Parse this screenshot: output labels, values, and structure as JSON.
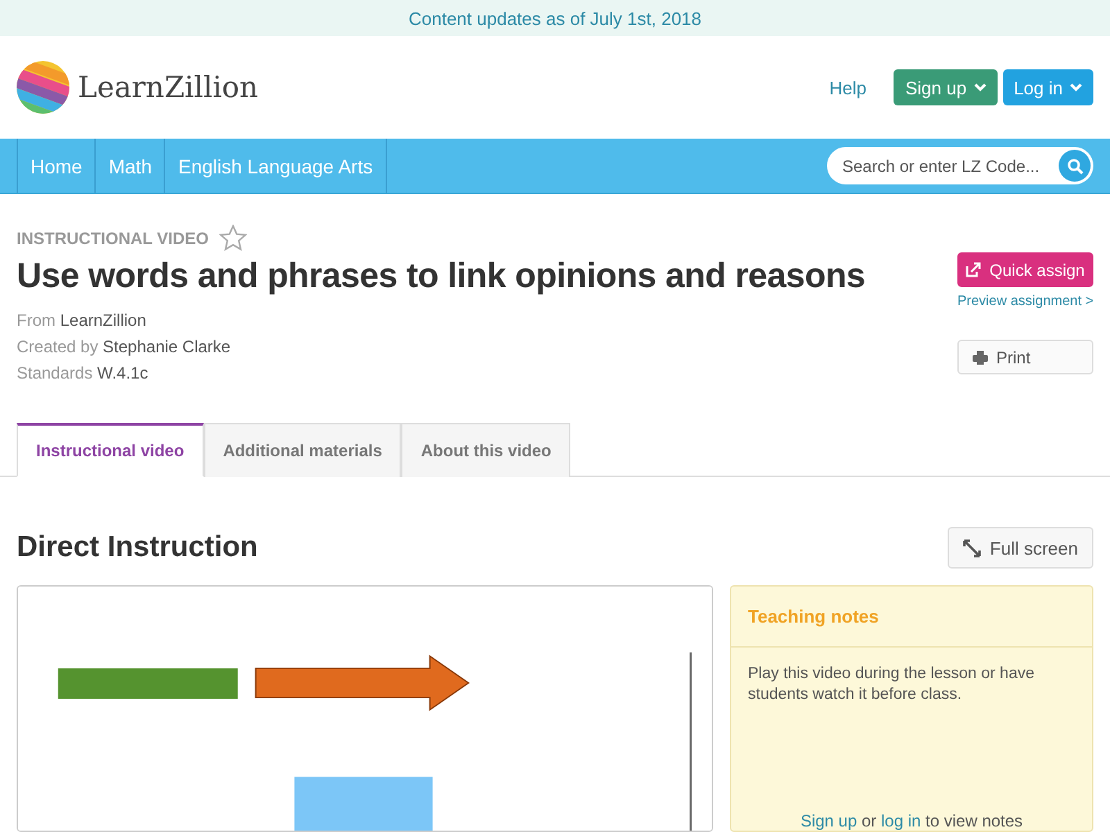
{
  "banner": "Content updates as of July 1st, 2018",
  "header": {
    "logo_text": "LearnZillion",
    "help": "Help",
    "buttons": [
      {
        "label": "Sign up",
        "kind": "signup"
      },
      {
        "label": "Log in",
        "kind": "login"
      }
    ]
  },
  "nav": {
    "items": [
      {
        "label": "Home"
      },
      {
        "label": "Math"
      },
      {
        "label": "English Language Arts"
      }
    ],
    "search": {
      "placeholder": "Search or enter LZ Code..."
    }
  },
  "lesson": {
    "type_label": "INSTRUCTIONAL VIDEO",
    "favorited": false,
    "title": "Use words and phrases to link opinions and reasons",
    "meta": [
      {
        "label": "From",
        "value": "LearnZillion"
      },
      {
        "label": "Created by",
        "value": "Stephanie Clarke"
      },
      {
        "label": "Standards",
        "value": "W.4.1c"
      }
    ],
    "quick_assign": "Quick assign",
    "preview_link": "Preview assignment >",
    "print": "Print"
  },
  "tabs": [
    {
      "label": "Instructional video",
      "selected": true
    },
    {
      "label": "Additional materials",
      "selected": false
    },
    {
      "label": "About this video",
      "selected": false
    }
  ],
  "section": {
    "title": "Direct Instruction",
    "full_screen": "Full screen"
  },
  "notes": {
    "title": "Teaching notes",
    "body": "Play this video during the lesson or have students watch it before class.",
    "footer": [
      {
        "text": "Sign up",
        "link": true
      },
      {
        "text": " or ",
        "link": false
      },
      {
        "text": "log in",
        "link": true
      },
      {
        "text": " to view notes",
        "link": false
      }
    ]
  }
}
